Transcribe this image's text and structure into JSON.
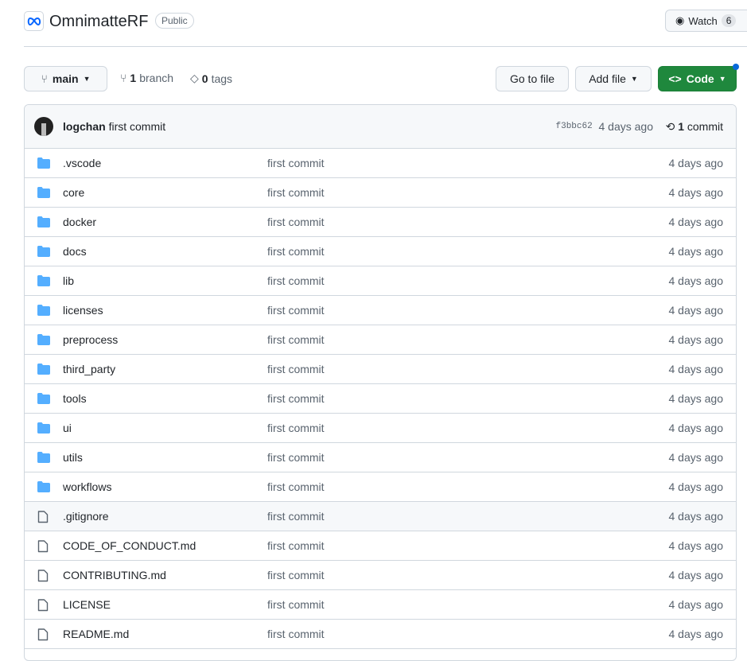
{
  "repo": {
    "name": "OmnimatteRF",
    "visibility": "Public",
    "watch_label": "Watch",
    "watch_count": "6"
  },
  "toolbar": {
    "branch": "main",
    "branch_count": "1",
    "branch_label": "branch",
    "tag_count": "0",
    "tag_label": "tags",
    "go_to_file": "Go to file",
    "add_file": "Add file",
    "code": "Code"
  },
  "commit": {
    "author": "logchan",
    "message": "first commit",
    "sha": "f3bbc62",
    "age": "4 days ago",
    "count": "1",
    "count_label": "commit"
  },
  "files": [
    {
      "type": "dir",
      "name": ".vscode",
      "message": "first commit",
      "age": "4 days ago"
    },
    {
      "type": "dir",
      "name": "core",
      "message": "first commit",
      "age": "4 days ago"
    },
    {
      "type": "dir",
      "name": "docker",
      "message": "first commit",
      "age": "4 days ago"
    },
    {
      "type": "dir",
      "name": "docs",
      "message": "first commit",
      "age": "4 days ago"
    },
    {
      "type": "dir",
      "name": "lib",
      "message": "first commit",
      "age": "4 days ago"
    },
    {
      "type": "dir",
      "name": "licenses",
      "message": "first commit",
      "age": "4 days ago"
    },
    {
      "type": "dir",
      "name": "preprocess",
      "message": "first commit",
      "age": "4 days ago"
    },
    {
      "type": "dir",
      "name": "third_party",
      "message": "first commit",
      "age": "4 days ago"
    },
    {
      "type": "dir",
      "name": "tools",
      "message": "first commit",
      "age": "4 days ago"
    },
    {
      "type": "dir",
      "name": "ui",
      "message": "first commit",
      "age": "4 days ago"
    },
    {
      "type": "dir",
      "name": "utils",
      "message": "first commit",
      "age": "4 days ago"
    },
    {
      "type": "dir",
      "name": "workflows",
      "message": "first commit",
      "age": "4 days ago"
    },
    {
      "type": "file",
      "name": ".gitignore",
      "message": "first commit",
      "age": "4 days ago"
    },
    {
      "type": "file",
      "name": "CODE_OF_CONDUCT.md",
      "message": "first commit",
      "age": "4 days ago"
    },
    {
      "type": "file",
      "name": "CONTRIBUTING.md",
      "message": "first commit",
      "age": "4 days ago"
    },
    {
      "type": "file",
      "name": "LICENSE",
      "message": "first commit",
      "age": "4 days ago"
    },
    {
      "type": "file",
      "name": "README.md",
      "message": "first commit",
      "age": "4 days ago"
    }
  ],
  "colors": {
    "folder": "#54aeff",
    "green": "#1f883d",
    "accent": "#0969da"
  }
}
